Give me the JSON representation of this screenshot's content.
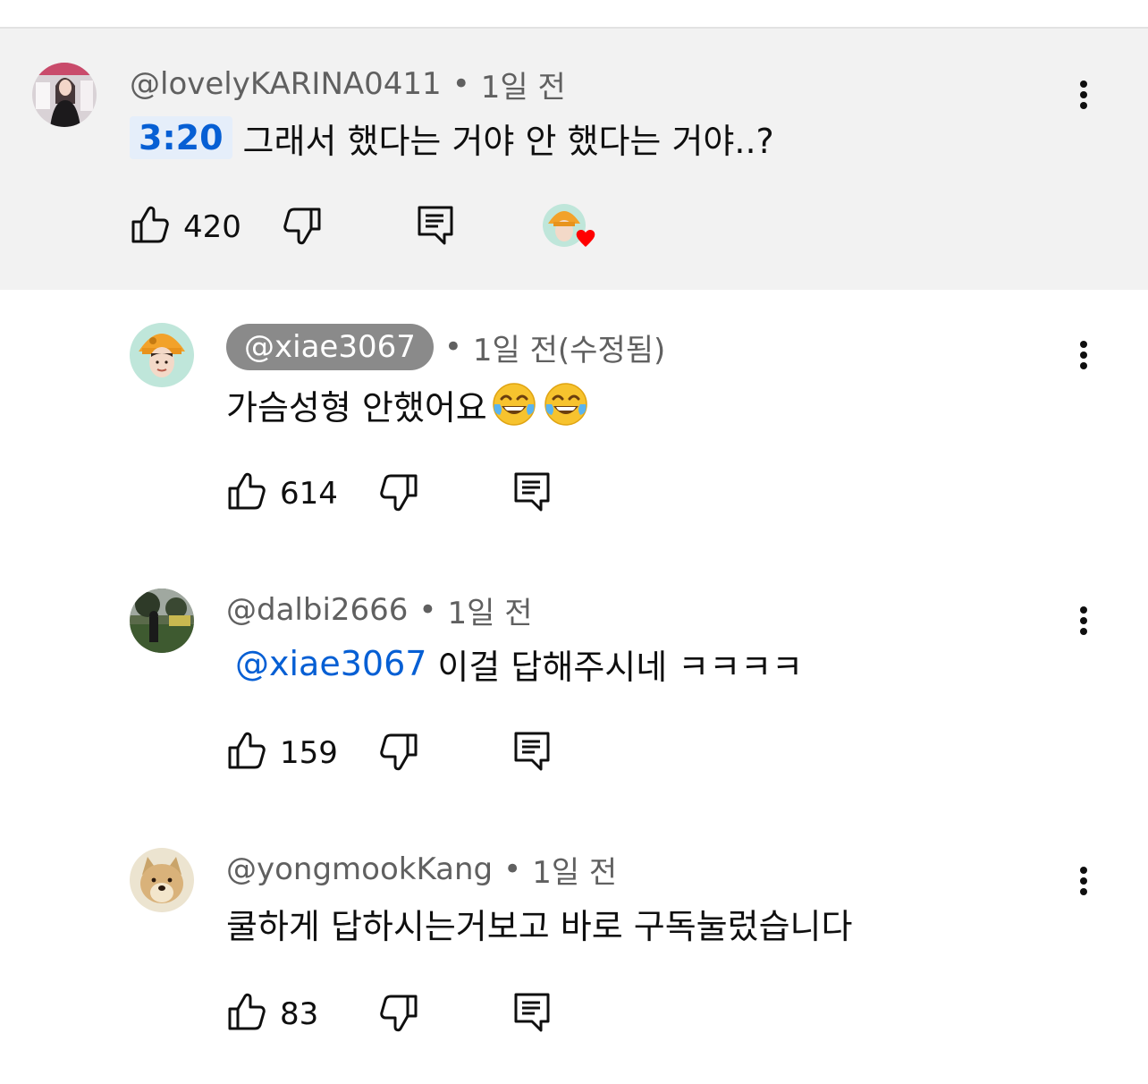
{
  "comments": [
    {
      "handle": "@lovelyKARINA0411",
      "time": "1일 전",
      "timestamp": "3:20",
      "text": "그래서 했다는 거야 안 했다는 거야..?",
      "likes": "420",
      "hearted_by_creator": true
    },
    {
      "handle": "@xiae3067",
      "time": "1일 전(수정됨)",
      "text": "가슴성형 안했어요",
      "likes": "614",
      "is_creator": true
    },
    {
      "handle": "@dalbi2666",
      "time": "1일 전",
      "mention": "@xiae3067",
      "text": "이걸 답해주시네 ㅋㅋㅋㅋ",
      "likes": "159"
    },
    {
      "handle": "@yongmookKang",
      "time": "1일 전",
      "text": "쿨하게 답하시는거보고 바로 구독눌렀습니다",
      "likes": "83"
    }
  ],
  "separator": "•",
  "icons": {
    "like": "thumbs-up-icon",
    "dislike": "thumbs-down-icon",
    "reply": "reply-icon",
    "more": "more-vertical-icon",
    "emoji": "tears-of-joy-emoji"
  },
  "colors": {
    "link": "#065fd4",
    "heart": "#ff0000",
    "highlight_bg": "#f2f2f2"
  }
}
